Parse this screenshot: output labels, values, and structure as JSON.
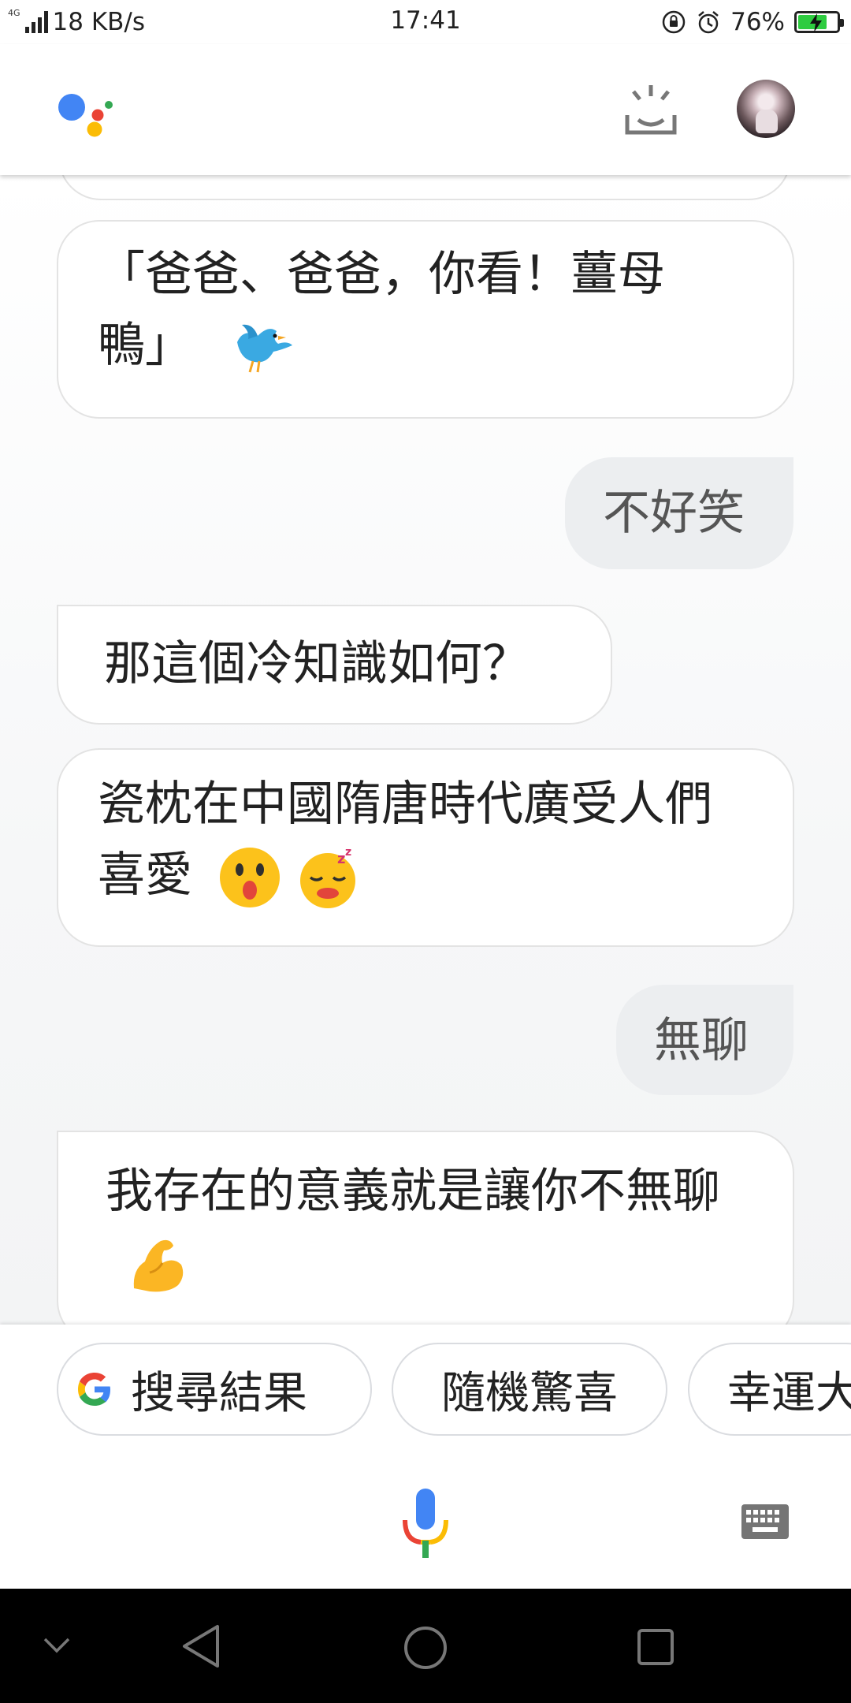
{
  "status_bar": {
    "network_type": "4G",
    "speed": "18 KB/s",
    "time": "17:41",
    "battery_percent": "76%",
    "battery_level": 0.76,
    "battery_color": "#2ecc40"
  },
  "header": {
    "logo": "google-assistant-dots-icon",
    "updates_icon": "snapshot-tray-icon",
    "avatar": "user-avatar"
  },
  "conversation": {
    "messages": [
      {
        "from": "assistant",
        "text": "「爸爸、爸爸，你看！薑母鴨」",
        "emoji": [
          "bird"
        ]
      },
      {
        "from": "user",
        "text": "不好笑"
      },
      {
        "from": "assistant",
        "text": "那這個冷知識如何？"
      },
      {
        "from": "assistant",
        "text": "瓷枕在中國隋唐時代廣受人們喜愛",
        "emoji": [
          "hushed-face",
          "sleeping-face"
        ]
      },
      {
        "from": "user",
        "text": "無聊"
      },
      {
        "from": "assistant",
        "text": "我存在的意義就是讓你不無聊",
        "emoji": [
          "flexed-biceps"
        ]
      }
    ]
  },
  "suggestions": [
    {
      "label": "搜尋結果",
      "icon": "google-g-icon"
    },
    {
      "label": "隨機驚喜"
    },
    {
      "label": "幸運大"
    }
  ],
  "input_bar": {
    "mic_icon": "mic-icon",
    "keyboard_icon": "keyboard-icon"
  },
  "nav_bar": {
    "items": [
      "collapse-icon",
      "back-icon",
      "home-icon",
      "recents-icon"
    ]
  },
  "colors": {
    "assistant_bubble": "#ffffff",
    "user_bubble": "#eceef0",
    "google_blue": "#4285f4",
    "google_red": "#ea4335",
    "google_yellow": "#fbbc05",
    "google_green": "#34a853"
  }
}
